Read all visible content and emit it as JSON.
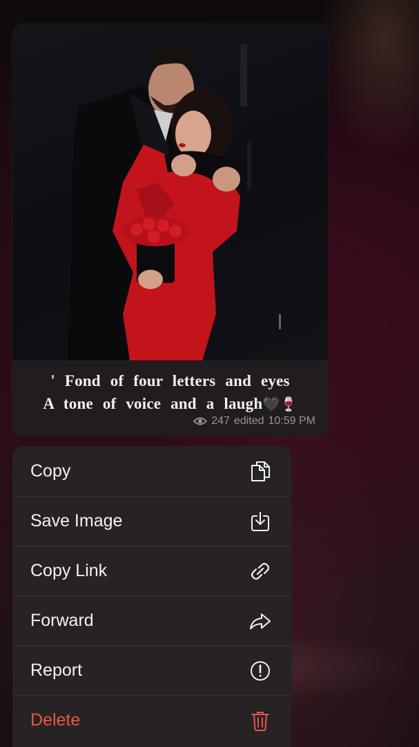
{
  "message": {
    "caption_lines": [
      "' Fond of four letters and eyes",
      "A tone of voice and a laugh"
    ],
    "caption_emoji": "🖤🍷",
    "views": "247",
    "edited_label": "edited",
    "time": "10:59 PM"
  },
  "menu": {
    "items": [
      {
        "label": "Copy",
        "icon": "copy-icon"
      },
      {
        "label": "Save Image",
        "icon": "save-image-icon"
      },
      {
        "label": "Copy Link",
        "icon": "link-icon"
      },
      {
        "label": "Forward",
        "icon": "forward-arrow-icon"
      },
      {
        "label": "Report",
        "icon": "report-exclamation-icon"
      },
      {
        "label": "Delete",
        "icon": "trash-icon"
      }
    ]
  },
  "colors": {
    "menu_background": "#272224",
    "destructive": "#e5574a",
    "bubble_background": "#211c1f"
  }
}
